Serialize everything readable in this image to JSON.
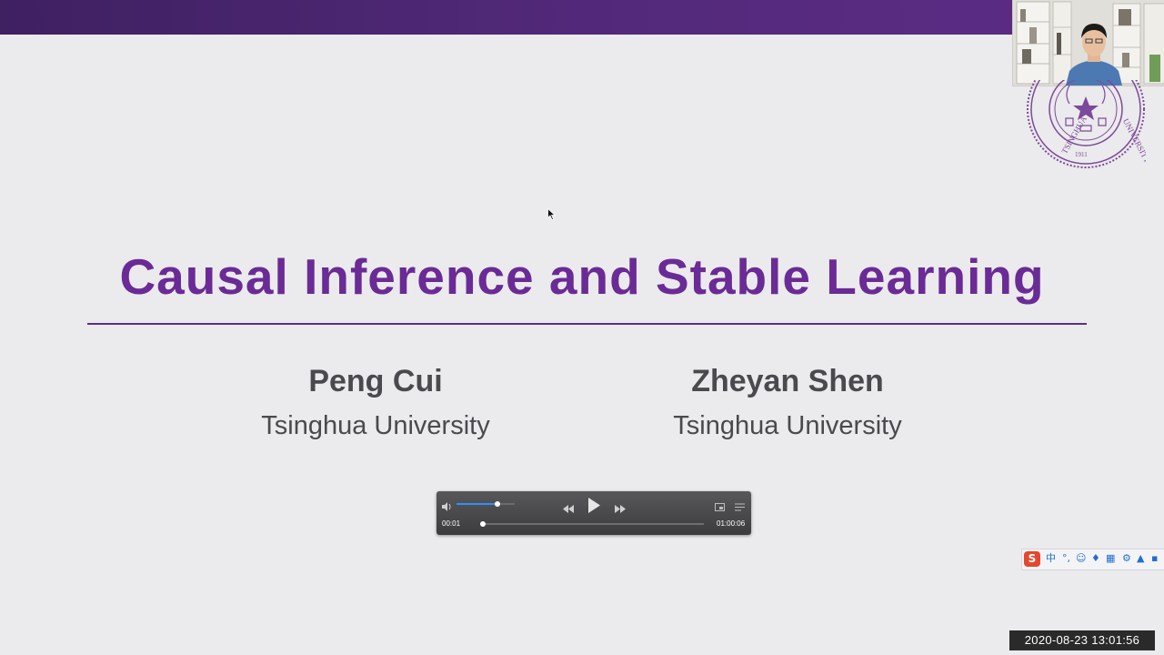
{
  "slide": {
    "title": "Causal Inference and Stable Learning",
    "authors": [
      {
        "name": "Peng Cui",
        "affiliation": "Tsinghua University"
      },
      {
        "name": "Zheyan Shen",
        "affiliation": "Tsinghua University"
      }
    ],
    "accent_color": "#6a2b96",
    "band_color": "#52297a"
  },
  "player": {
    "elapsed": "00:01",
    "duration": "01:00:06",
    "volume_fraction": 0.7,
    "progress_fraction": 0.001,
    "icons": [
      "volume-icon",
      "rewind-icon",
      "play-icon",
      "fast-forward-icon",
      "pip-icon",
      "playlist-icon"
    ]
  },
  "ime": {
    "logo": "S",
    "mode": "中"
  },
  "timestamp": "2020-08-23 13:01:56"
}
